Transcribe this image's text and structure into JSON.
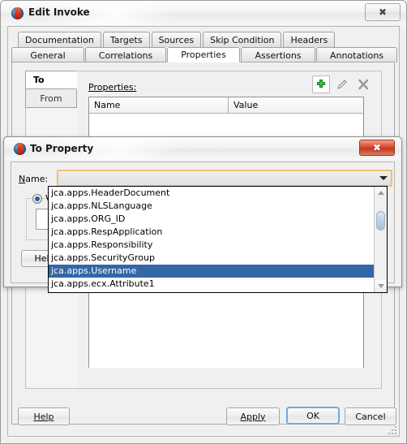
{
  "main_window": {
    "title": "Edit Invoke",
    "icon": "app-icon",
    "close_label": "✖",
    "tabs_row1": [
      {
        "label": "Documentation",
        "selected": false
      },
      {
        "label": "Targets",
        "selected": false
      },
      {
        "label": "Sources",
        "selected": false
      },
      {
        "label": "Skip Condition",
        "selected": false
      },
      {
        "label": "Headers",
        "selected": false
      }
    ],
    "tabs_row2": [
      {
        "label": "General",
        "selected": false
      },
      {
        "label": "Correlations",
        "selected": false
      },
      {
        "label": "Properties",
        "selected": true
      },
      {
        "label": "Assertions",
        "selected": false
      },
      {
        "label": "Annotations",
        "selected": false
      }
    ],
    "side_tabs": [
      {
        "label": "To",
        "selected": true
      },
      {
        "label": "From",
        "selected": false
      }
    ],
    "properties_label": "Properties:",
    "toolbar": [
      {
        "name": "add-property-button",
        "glyph": "✚"
      },
      {
        "name": "edit-property-button",
        "glyph": "✎"
      },
      {
        "name": "delete-property-button",
        "glyph": "✖"
      }
    ],
    "table": {
      "columns": [
        "Name",
        "Value"
      ],
      "rows": []
    },
    "buttons": {
      "help": "Help",
      "apply": "Apply",
      "ok": "OK",
      "cancel": "Cancel"
    }
  },
  "to_property_dialog": {
    "title": "To Property",
    "close_label": "✖",
    "name_label": "Name:",
    "name_value": "",
    "name_placeholder": "",
    "radio_label": "Value",
    "value_input": "",
    "help": "Help"
  },
  "dropdown": {
    "selected_index": 6,
    "items": [
      "jca.apps.HeaderDocument",
      "jca.apps.NLSLanguage",
      "jca.apps.ORG_ID",
      "jca.apps.RespApplication",
      "jca.apps.Responsibility",
      "jca.apps.SecurityGroup",
      "jca.apps.Username",
      "jca.apps.ecx.Attribute1"
    ]
  },
  "colors": {
    "selection_blue": "#3467a6",
    "focus_orange": "#f0c070",
    "close_red": "#d9543a",
    "add_green": "#33b033"
  }
}
